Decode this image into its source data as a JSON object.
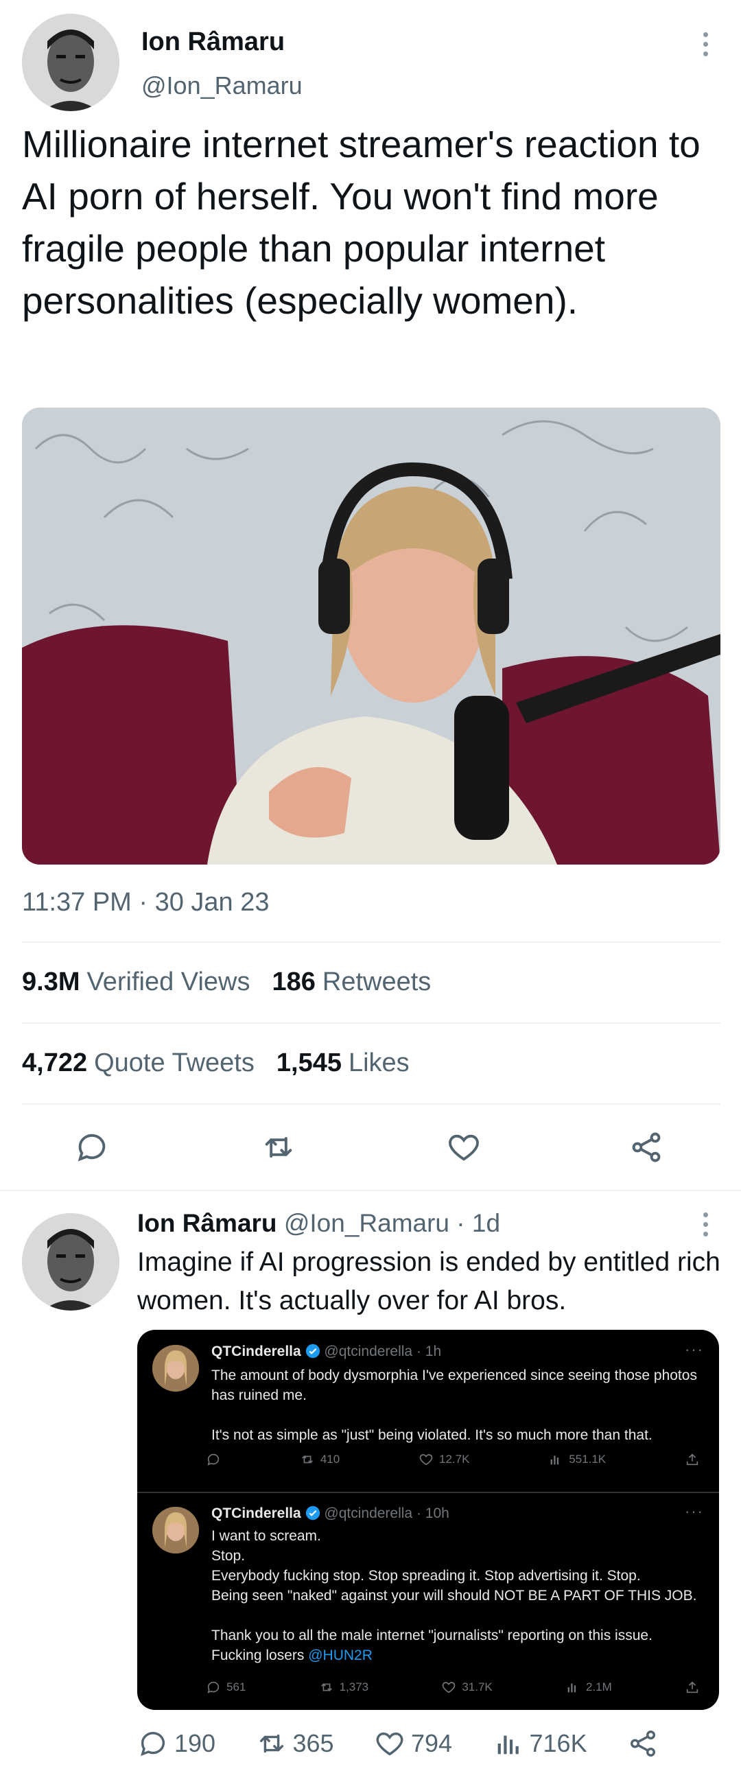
{
  "main_tweet": {
    "author": {
      "name": "Ion Râmaru",
      "handle": "@Ion_Ramaru"
    },
    "text": "Millionaire internet streamer's reaction to AI porn of herself. You won't find more fragile people than popular internet personalities (especially women).",
    "timestamp": "11:37 PM · 30 Jan 23",
    "stats": {
      "views_count": "9.3M",
      "views_label": "Verified Views",
      "retweets_count": "186",
      "retweets_label": "Retweets",
      "quotes_count": "4,722",
      "quotes_label": "Quote Tweets",
      "likes_count": "1,545",
      "likes_label": "Likes"
    },
    "actions": [
      "reply-icon",
      "retweet-icon",
      "like-icon",
      "share-icon"
    ]
  },
  "reply_tweet": {
    "author": {
      "name": "Ion Râmaru",
      "handle": "@Ion_Ramaru",
      "time": "· 1d"
    },
    "text": "Imagine if AI progression is ended by entitled rich women. It's actually over for AI bros.",
    "embedded": [
      {
        "name": "QTCinderella",
        "handle": "@qtcinderella",
        "time": "· 1h",
        "more": "···",
        "text": "The amount of body dysmorphia I've experienced since seeing those photos has ruined me.\n\nIt's not as simple as \"just\" being violated. It's so much more than that.",
        "retweets": "410",
        "likes": "12.7K",
        "views": "551.1K"
      },
      {
        "name": "QTCinderella",
        "handle": "@qtcinderella",
        "time": "· 10h",
        "more": "···",
        "text": "I want to scream.\nStop.\nEverybody fucking stop. Stop spreading it. Stop advertising it. Stop.\nBeing seen \"naked\" against your will should NOT BE A PART OF THIS JOB.\n\nThank you to all the male internet \"journalists\" reporting on this issue.\nFucking losers ",
        "mention": "@HUN2R",
        "replies": "561",
        "retweets": "1,373",
        "likes": "31.7K",
        "views": "2.1M"
      }
    ],
    "actions": {
      "replies": "190",
      "retweets": "365",
      "likes": "794",
      "views": "716K"
    }
  },
  "colors": {
    "text_primary": "#0f1419",
    "text_secondary": "#536471",
    "divider": "#eff3f4",
    "dark_bg": "#000000",
    "link_blue": "#1d9bf0"
  }
}
